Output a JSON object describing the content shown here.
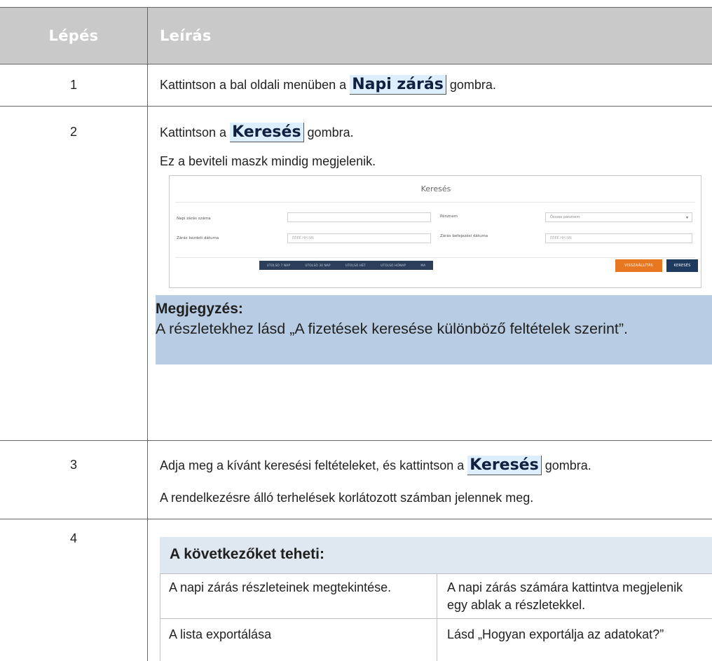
{
  "table": {
    "header": {
      "step": "Lépés",
      "description": "Leírás"
    },
    "rows": [
      {
        "step": "1",
        "text_before": "Kattintson a bal oldali menüben a ",
        "button": "Napi zárás",
        "text_after": " gombra."
      },
      {
        "step": "2",
        "text_before": "Kattintson a ",
        "button": "Keresés",
        "text_after": " gombra.",
        "line2": "Ez a beviteli maszk mindig megjelenik."
      },
      {
        "step": "3",
        "text_before": "Adja meg a kívánt keresési feltételeket, és kattintson a ",
        "button": "Keresés",
        "text_after": " gombra.",
        "line2": "A rendelkezésre álló terhelések korlátozott számban jelennek meg."
      },
      {
        "step": "4"
      }
    ]
  },
  "search_mask": {
    "title": "Keresés",
    "fields": {
      "closing_number_label": "Napi zárás száma",
      "currency_label": "Pénznem",
      "currency_value": "Összes pénznem",
      "start_date_label": "Zárás kezdeti dátuma",
      "start_date_placeholder": "ÉÉÉÉ.HH.NN",
      "end_date_label": "Zárás befejezési dátuma",
      "end_date_placeholder": "ÉÉÉÉ.HH.NN"
    },
    "quick_buttons": [
      "UTOLSÓ 7 NAP",
      "UTOLSÓ 30 NAP",
      "UTOLSÓ HÉT",
      "UTOLSÓ HÓNAP",
      "MA"
    ],
    "reset_label": "VISSZAÁLLÍTÁS",
    "search_label": "KERESÉS",
    "colors": {
      "reset": "#e87722",
      "search": "#1f3a5f",
      "quickbar": "#2c3e5a"
    }
  },
  "note": {
    "title": "Megjegyzés:",
    "body": "A részletekhez lásd „A fizetések keresése különböző feltételek szerint”."
  },
  "options": {
    "title": "A következőket teheti:",
    "rows": [
      {
        "action": "A napi zárás részleteinek megtekintése.",
        "how": "A napi zárás számára kattintva megjelenik egy ablak a részletekkel."
      },
      {
        "action": "A lista exportálása",
        "how": "Lásd „Hogyan exportálja az adatokat?”"
      }
    ]
  },
  "colors": {
    "header_bg": "#c9c9c9",
    "button_ref_bg": "#ddeeff",
    "note_bg": "#b8cde3",
    "options_head_bg": "#dfe7f0"
  }
}
